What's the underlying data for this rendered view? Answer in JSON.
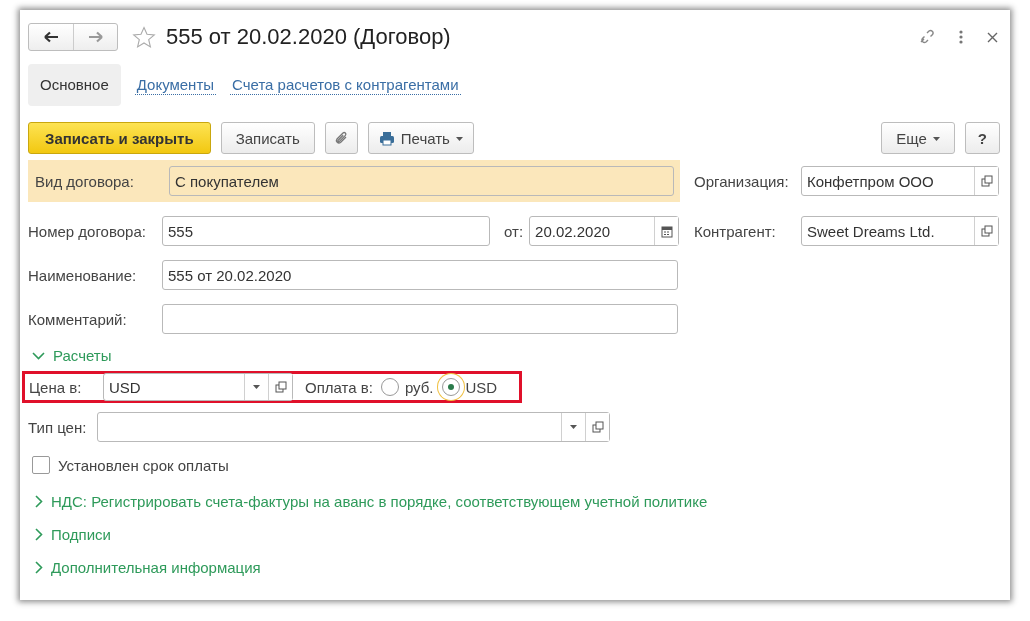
{
  "window": {
    "title": "555 от 20.02.2020 (Договор)",
    "favorite": false
  },
  "tabs": [
    {
      "label": "Основное",
      "selected": true
    },
    {
      "label": "Документы",
      "selected": false
    },
    {
      "label": "Счета расчетов с контрагентами",
      "selected": false
    }
  ],
  "toolbar": {
    "save_close": "Записать и закрыть",
    "save": "Записать",
    "print": "Печать",
    "more": "Еще",
    "help": "?"
  },
  "contract_type": {
    "label": "Вид договора:",
    "value": "С покупателем"
  },
  "number": {
    "label": "Номер договора:",
    "value": "555",
    "date_label": "от:",
    "date": "20.02.2020"
  },
  "name": {
    "label": "Наименование:",
    "value": "555 от 20.02.2020"
  },
  "comment": {
    "label": "Комментарий:"
  },
  "organization": {
    "label": "Организация:",
    "value": "Конфетпром ООО"
  },
  "counterparty": {
    "label": "Контрагент:",
    "value": "Sweet Dreams Ltd."
  },
  "settlements": {
    "title": "Расчеты",
    "expanded": true,
    "price_in": {
      "label": "Цена в:",
      "value": "USD"
    },
    "payment_in": {
      "label": "Оплата в:",
      "options": [
        {
          "label": "руб.",
          "selected": false
        },
        {
          "label": "USD",
          "selected": true
        }
      ]
    },
    "highlighted": true,
    "price_type": {
      "label": "Тип цен:"
    },
    "payment_term": {
      "label": "Установлен срок оплаты",
      "checked": false
    }
  },
  "sections": [
    {
      "title": "НДС: Регистрировать счета-фактуры на аванс в порядке, соответствующем учетной политике",
      "expanded": false
    },
    {
      "title": "Подписи",
      "expanded": false
    },
    {
      "title": "Дополнительная информация",
      "expanded": false
    }
  ]
}
